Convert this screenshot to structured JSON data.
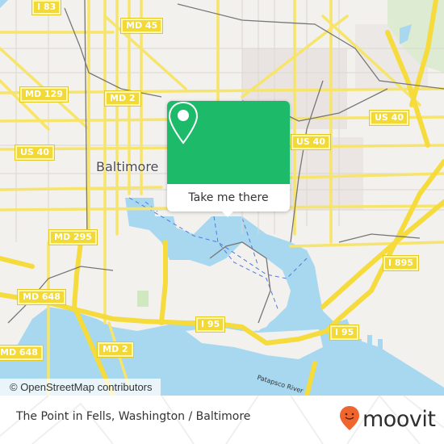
{
  "map": {
    "city_label": "Baltimore",
    "river_label": "Patapsco River",
    "attribution": "© OpenStreetMap contributors",
    "road_shields": [
      {
        "label": "I 83"
      },
      {
        "label": "MD 45"
      },
      {
        "label": "MD 129"
      },
      {
        "label": "MD 2"
      },
      {
        "label": "US 40"
      },
      {
        "label": "US 40"
      },
      {
        "label": "US 40"
      },
      {
        "label": "MD 295"
      },
      {
        "label": "MD 648"
      },
      {
        "label": "MD 648"
      },
      {
        "label": "MD 2"
      },
      {
        "label": "I 95"
      },
      {
        "label": "I 95"
      },
      {
        "label": "I 895"
      }
    ],
    "colors": {
      "land": "#f2f1ee",
      "water": "#a7d8ef",
      "road": "#f7e46a",
      "park": "#cfe8c0"
    }
  },
  "popup": {
    "icon": "location-pin-icon",
    "button_label": "Take me there",
    "color": "#1dba6a"
  },
  "footer": {
    "place_title": "The Point in Fells, Washington / Baltimore",
    "brand": "moovit",
    "brand_icon": "moovit-pin-icon",
    "brand_color": "#f0642e"
  }
}
